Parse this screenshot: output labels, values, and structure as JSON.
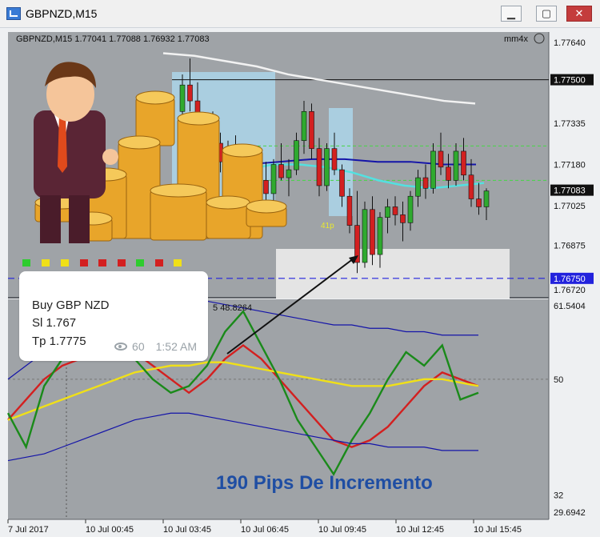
{
  "window": {
    "title": "GBPNZD,M15",
    "minimize": "▁",
    "maximize": "▢",
    "close": "✕"
  },
  "chart_header": {
    "symbol_ohlc": "GBPNZD,M15  1.77041 1.77088 1.76932 1.77083",
    "ea_label": "mm4x"
  },
  "message": {
    "line1": "Buy GBP NZD",
    "line2": "Sl 1.767",
    "line3": "Tp 1.7775",
    "views": "60",
    "time": "1:52 AM"
  },
  "promo_text": "190 Pips De Incremento",
  "colors": {
    "chart_bg": "#9fa3a7",
    "bull": "#2faa2f",
    "bear": "#d32020",
    "blue_line": "#1414a8",
    "cyan_line": "#54e0e0",
    "white_ma": "#f2f2f2",
    "zone": "#abd6ea",
    "promo": "#1f4ea3"
  },
  "chart_data": [
    {
      "type": "candlestick",
      "title": "GBPNZD,M15",
      "price_axis_labels": [
        "1.77640",
        "1.77500",
        "1.77335",
        "1.77180",
        "1.77083",
        "1.77025",
        "1.76875",
        "1.76750",
        "1.76720"
      ],
      "time_axis_labels": [
        "7 Jul 2017",
        "10 Jul 00:45",
        "10 Jul 03:45",
        "10 Jul 06:45",
        "10 Jul 09:45",
        "10 Jul 12:45",
        "10 Jul 15:45"
      ],
      "ylim": [
        1.7668,
        1.7768
      ],
      "horizontal_levels": [
        {
          "price": 1.775,
          "label": "1.77500",
          "style": "solid"
        },
        {
          "price": 1.77083,
          "label": "1.77083",
          "style": "current"
        },
        {
          "price": 1.7675,
          "label": "1.76750",
          "style": "dashed"
        }
      ],
      "annotations": [
        "41p"
      ],
      "last_ohlc": {
        "open": 1.77041,
        "high": 1.77088,
        "low": 1.76932,
        "close": 1.77083
      },
      "candles": [
        {
          "o": 1.7738,
          "h": 1.7752,
          "l": 1.7731,
          "c": 1.7748
        },
        {
          "o": 1.7748,
          "h": 1.7758,
          "l": 1.7738,
          "c": 1.7742
        },
        {
          "o": 1.7742,
          "h": 1.7749,
          "l": 1.7723,
          "c": 1.7727
        },
        {
          "o": 1.7727,
          "h": 1.7733,
          "l": 1.7716,
          "c": 1.7731
        },
        {
          "o": 1.7731,
          "h": 1.7738,
          "l": 1.7724,
          "c": 1.7726
        },
        {
          "o": 1.7726,
          "h": 1.773,
          "l": 1.7715,
          "c": 1.7719
        },
        {
          "o": 1.7719,
          "h": 1.7727,
          "l": 1.7712,
          "c": 1.7723
        },
        {
          "o": 1.7723,
          "h": 1.7729,
          "l": 1.7717,
          "c": 1.772
        },
        {
          "o": 1.772,
          "h": 1.7725,
          "l": 1.7711,
          "c": 1.7714
        },
        {
          "o": 1.7714,
          "h": 1.7719,
          "l": 1.7708,
          "c": 1.7716
        },
        {
          "o": 1.7716,
          "h": 1.7722,
          "l": 1.771,
          "c": 1.7712
        },
        {
          "o": 1.7712,
          "h": 1.7719,
          "l": 1.7704,
          "c": 1.7707
        },
        {
          "o": 1.7707,
          "h": 1.772,
          "l": 1.7703,
          "c": 1.7718
        },
        {
          "o": 1.7718,
          "h": 1.7726,
          "l": 1.7712,
          "c": 1.7713
        },
        {
          "o": 1.7713,
          "h": 1.772,
          "l": 1.7706,
          "c": 1.7716
        },
        {
          "o": 1.7716,
          "h": 1.773,
          "l": 1.7714,
          "c": 1.7727
        },
        {
          "o": 1.7727,
          "h": 1.7742,
          "l": 1.7722,
          "c": 1.7738
        },
        {
          "o": 1.7738,
          "h": 1.7741,
          "l": 1.772,
          "c": 1.7724
        },
        {
          "o": 1.7724,
          "h": 1.7728,
          "l": 1.7706,
          "c": 1.771
        },
        {
          "o": 1.771,
          "h": 1.7726,
          "l": 1.7708,
          "c": 1.7724
        },
        {
          "o": 1.7724,
          "h": 1.773,
          "l": 1.7714,
          "c": 1.7716
        },
        {
          "o": 1.7716,
          "h": 1.7718,
          "l": 1.7702,
          "c": 1.7706
        },
        {
          "o": 1.7706,
          "h": 1.7709,
          "l": 1.7692,
          "c": 1.7695
        },
        {
          "o": 1.7695,
          "h": 1.7708,
          "l": 1.7677,
          "c": 1.7681
        },
        {
          "o": 1.7681,
          "h": 1.7704,
          "l": 1.7679,
          "c": 1.7701
        },
        {
          "o": 1.7701,
          "h": 1.7706,
          "l": 1.768,
          "c": 1.7684
        },
        {
          "o": 1.7684,
          "h": 1.77,
          "l": 1.7679,
          "c": 1.7698
        },
        {
          "o": 1.7698,
          "h": 1.7705,
          "l": 1.7692,
          "c": 1.7702
        },
        {
          "o": 1.7702,
          "h": 1.7706,
          "l": 1.7695,
          "c": 1.7699
        },
        {
          "o": 1.7699,
          "h": 1.7704,
          "l": 1.7689,
          "c": 1.7696
        },
        {
          "o": 1.7696,
          "h": 1.7708,
          "l": 1.7693,
          "c": 1.7706
        },
        {
          "o": 1.7706,
          "h": 1.7716,
          "l": 1.7702,
          "c": 1.7713
        },
        {
          "o": 1.7713,
          "h": 1.7718,
          "l": 1.7705,
          "c": 1.7709
        },
        {
          "o": 1.7709,
          "h": 1.7726,
          "l": 1.7707,
          "c": 1.7723
        },
        {
          "o": 1.7723,
          "h": 1.773,
          "l": 1.7714,
          "c": 1.7717
        },
        {
          "o": 1.7717,
          "h": 1.7722,
          "l": 1.7709,
          "c": 1.7712
        },
        {
          "o": 1.7712,
          "h": 1.7726,
          "l": 1.771,
          "c": 1.7723
        },
        {
          "o": 1.7723,
          "h": 1.7728,
          "l": 1.7712,
          "c": 1.7714
        },
        {
          "o": 1.7714,
          "h": 1.772,
          "l": 1.7702,
          "c": 1.7705
        },
        {
          "o": 1.7705,
          "h": 1.7711,
          "l": 1.7699,
          "c": 1.7702
        },
        {
          "o": 1.7702,
          "h": 1.7709,
          "l": 1.7697,
          "c": 1.7708
        }
      ]
    },
    {
      "type": "line",
      "title": "indicator panel",
      "header_value": "48.8264",
      "axis_labels": [
        "61.5404",
        "50",
        "32",
        "29.6942"
      ],
      "ylim": [
        29.6942,
        61.5404
      ],
      "series": [
        {
          "color": "#d32020",
          "values": [
            44,
            47,
            50,
            52,
            53,
            55,
            56,
            54,
            52,
            50,
            48,
            50,
            53,
            55,
            53,
            50,
            47,
            44,
            41,
            40,
            41,
            43,
            46,
            49,
            51,
            50,
            49
          ]
        },
        {
          "color": "#f0e018",
          "values": [
            44,
            45,
            46,
            47,
            48,
            49,
            50,
            51,
            51.5,
            52,
            52,
            52.5,
            52.5,
            52,
            51.5,
            51,
            50.5,
            50,
            49.5,
            49,
            49,
            49,
            49.5,
            50,
            50,
            49.5,
            49
          ]
        },
        {
          "color": "#1a8a1a",
          "values": [
            45,
            40,
            49,
            53,
            56,
            58,
            57,
            53,
            50,
            48,
            49,
            52,
            57,
            60,
            55,
            50,
            44,
            40,
            36,
            41,
            45,
            50,
            54,
            52,
            55,
            47,
            48
          ]
        },
        {
          "color": "#1414a8",
          "values": [
            50,
            52,
            54,
            56,
            57,
            58,
            59,
            60,
            61,
            61.5,
            62,
            61.5,
            61,
            60.5,
            60,
            59.5,
            59,
            58.5,
            58,
            58,
            57.5,
            57.5,
            57,
            57,
            56.5,
            56.5,
            56.5
          ]
        },
        {
          "color": "#1414a8",
          "values": [
            38,
            38.5,
            39,
            40,
            41,
            42,
            43,
            44,
            44.5,
            45,
            45,
            44.5,
            44,
            43.5,
            43,
            42.5,
            42,
            41.5,
            41,
            40.5,
            40.5,
            40,
            40,
            40,
            39.5,
            39.5,
            39.5
          ]
        }
      ]
    }
  ]
}
